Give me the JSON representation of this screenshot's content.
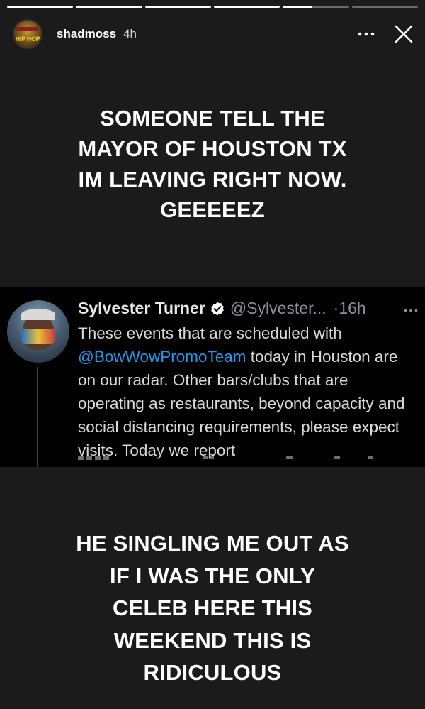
{
  "progress": {
    "segments": [
      1,
      1,
      1,
      1,
      0.45,
      0
    ]
  },
  "header": {
    "username": "shadmoss",
    "time": "4h",
    "avatar_logo_text": "HIP HOP"
  },
  "caption_top": {
    "lines": [
      "SOMEONE TELL THE",
      "MAYOR OF HOUSTON TX",
      "IM LEAVING RIGHT NOW.",
      "GEEEEEZ"
    ]
  },
  "tweet": {
    "name": "Sylvester Turner",
    "handle": "@Sylvester...",
    "time": "·16h",
    "body_before_mention": "These events that are scheduled with",
    "mention": "@BowWowPromoTeam",
    "body_after_mention": " today in Houston are on our radar. Other bars/clubs that are operating as restaurants, beyond capacity and social distancing requirements, please expect visits. Today we report"
  },
  "caption_bottom": {
    "lines": [
      "HE SINGLING ME OUT AS",
      "IF I WAS THE ONLY",
      "CELEB HERE THIS",
      "WEEKEND THIS IS",
      "RIDICULOUS"
    ]
  },
  "colors": {
    "story_background": "#1b1b1b",
    "tweet_background": "#000000",
    "mention": "#1d9bf0",
    "verified_badge": "#ffffff",
    "secondary_text": "#8b9299"
  },
  "icons": {
    "more": "more-horizontal-icon",
    "close": "close-icon",
    "verified": "verified-badge-icon"
  }
}
